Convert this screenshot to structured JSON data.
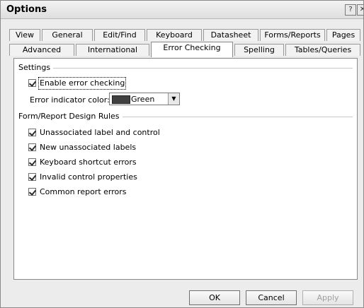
{
  "window": {
    "title": "Options"
  },
  "tabs": {
    "row1": [
      "View",
      "General",
      "Edit/Find",
      "Keyboard",
      "Datasheet",
      "Forms/Reports",
      "Pages"
    ],
    "row2": [
      "Advanced",
      "International",
      "Error Checking",
      "Spelling",
      "Tables/Queries"
    ],
    "active": "Error Checking"
  },
  "settings": {
    "title": "Settings",
    "enable_error_checking": {
      "label": "Enable error checking",
      "checked": true
    },
    "error_indicator_color": {
      "label": "Error indicator color:",
      "value": "Green",
      "swatch_color": "#404040"
    }
  },
  "design_rules": {
    "title": "Form/Report Design Rules",
    "items": [
      {
        "label": "Unassociated label and control",
        "checked": true
      },
      {
        "label": "New unassociated labels",
        "checked": true
      },
      {
        "label": "Keyboard shortcut errors",
        "checked": true
      },
      {
        "label": "Invalid control properties",
        "checked": true
      },
      {
        "label": "Common report errors",
        "checked": true
      }
    ]
  },
  "buttons": {
    "ok": "OK",
    "cancel": "Cancel",
    "apply": "Apply"
  }
}
